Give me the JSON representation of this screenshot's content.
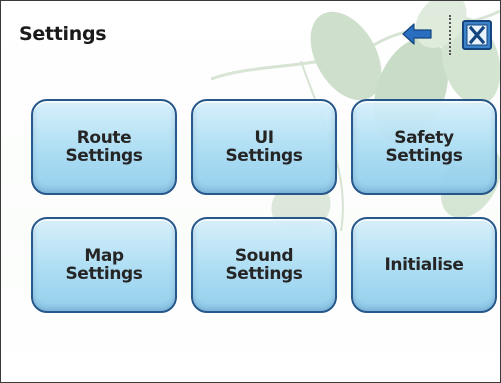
{
  "header": {
    "title": "Settings"
  },
  "icons": {
    "back": "back-arrow-icon",
    "close": "close-x-icon"
  },
  "colors": {
    "button_fill": "#a9dcf3",
    "button_border": "#1d4f86",
    "icon_blue": "#2a6fbf",
    "leaf_green": "#a7c7a3"
  },
  "buttons": [
    {
      "label": "Route\nSettings"
    },
    {
      "label": "UI\nSettings"
    },
    {
      "label": "Safety\nSettings"
    },
    {
      "label": "Map\nSettings"
    },
    {
      "label": "Sound\nSettings"
    },
    {
      "label": "Initialise"
    }
  ]
}
